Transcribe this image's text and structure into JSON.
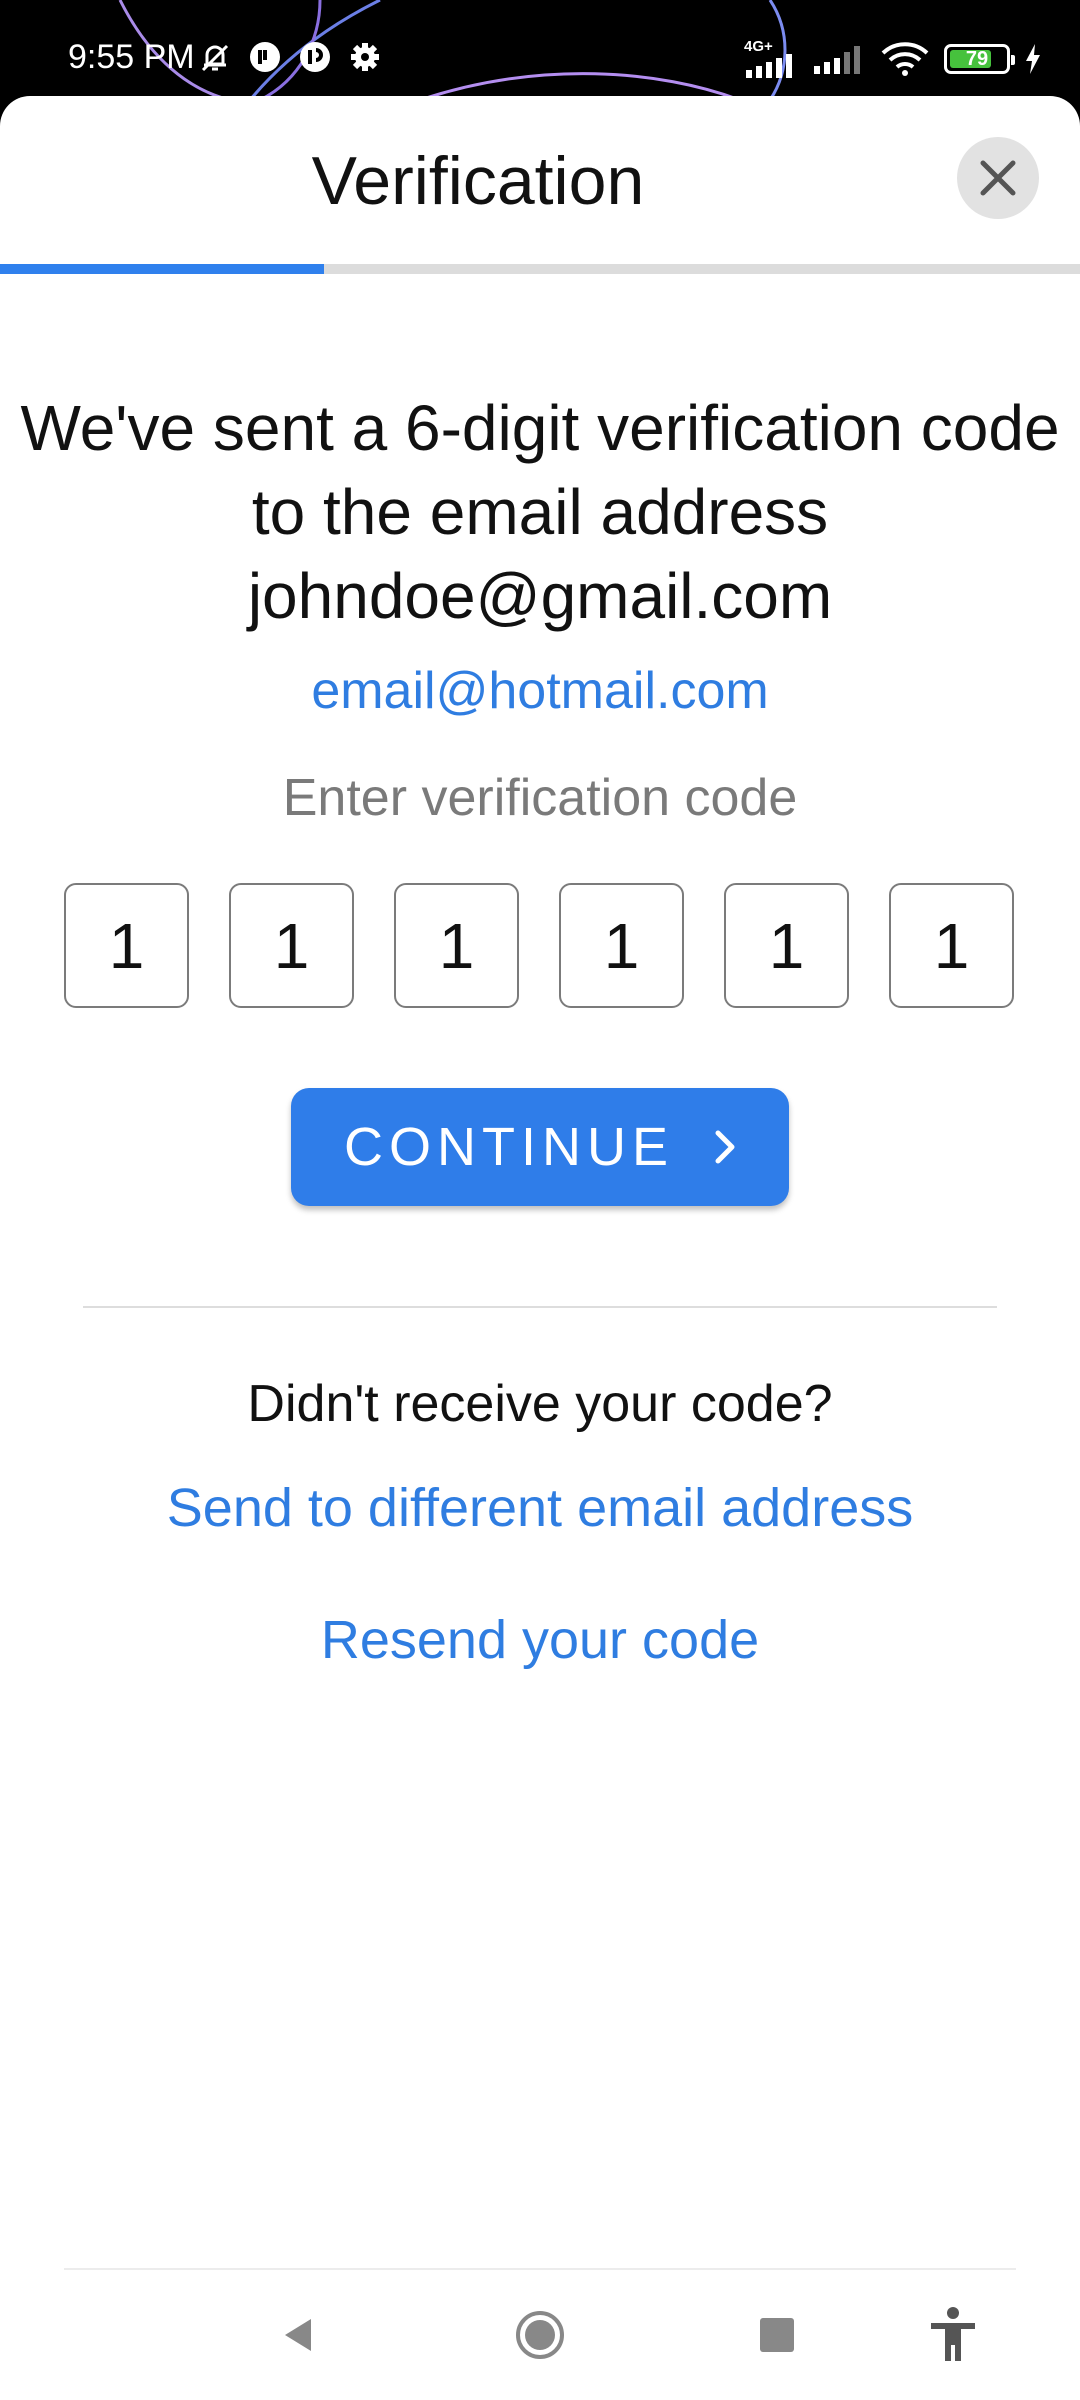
{
  "status_bar": {
    "time": "9:55 PM",
    "network_type": "4G+",
    "battery_level": "79",
    "battery_fraction": 0.79,
    "icons": [
      "mute-bell-icon",
      "notification-icon",
      "notification-icon",
      "settings-gear-icon",
      "signal-icon",
      "signal-icon",
      "wifi-icon",
      "battery-icon",
      "charging-bolt-icon"
    ]
  },
  "header": {
    "title": "Verification",
    "close_icon": "close-icon",
    "step_progress_fraction": 0.3
  },
  "message": {
    "text": "We've sent a 6-digit verification code to the email address johndoe@gmail.com",
    "alt_email": "email@hotmail.com"
  },
  "code": {
    "label": "Enter verification code",
    "digits": [
      "1",
      "1",
      "1",
      "1",
      "1",
      "1"
    ]
  },
  "continue_button": {
    "label": "CONTINUE",
    "icon": "chevron-right-icon"
  },
  "help": {
    "question": "Didn't receive your code?",
    "different_email_link": "Send to different email address",
    "resend_link": "Resend your code"
  },
  "nav_bar": {
    "icons": [
      "back-icon",
      "home-icon",
      "recents-icon",
      "accessibility-icon"
    ]
  },
  "colors": {
    "accent": "#2f7de9",
    "link": "#2f7de1",
    "battery_fill": "#46c23d"
  }
}
